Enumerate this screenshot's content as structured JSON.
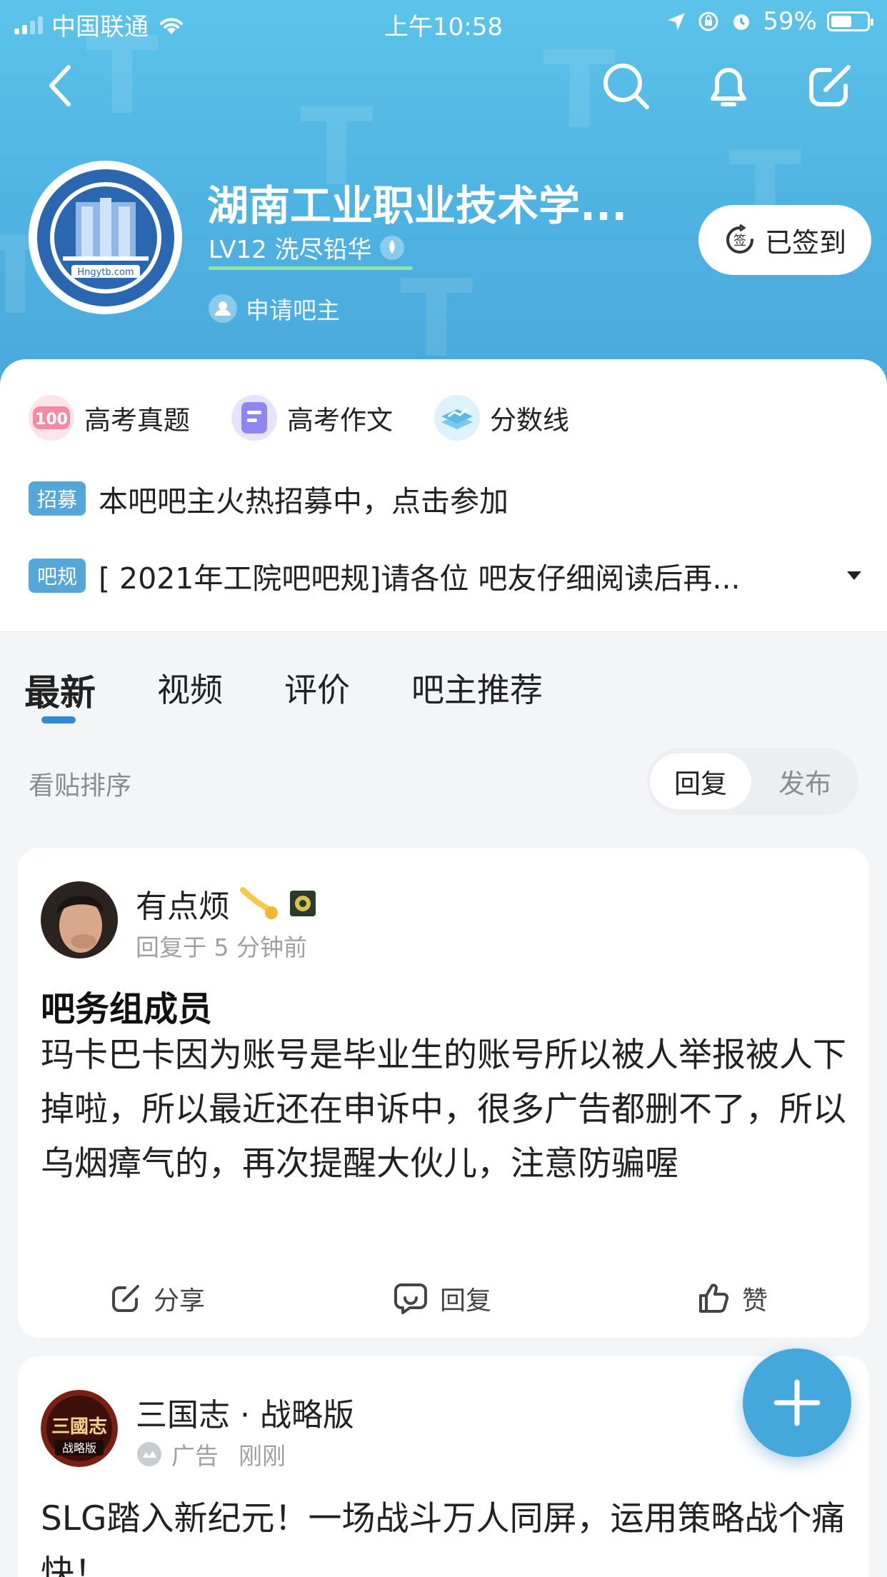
{
  "status_bar": {
    "carrier": "中国联通",
    "time": "上午10:58",
    "battery": "59%",
    "battery_level": 0.59
  },
  "forum": {
    "name": "湖南工业职业技术学...",
    "level": "LV12 洗尽铅华",
    "level_progress": 1.0,
    "apply_admin": "申请吧主",
    "checkin_label": "已签到",
    "checkin_icon_char": "签",
    "avatar_url_text": "Hngytb.com"
  },
  "shortcuts": [
    {
      "label": "高考真题",
      "icon": "100-icon",
      "color": "#f59ab0"
    },
    {
      "label": "高考作文",
      "icon": "essay-icon",
      "color": "#8f86f0"
    },
    {
      "label": "分数线",
      "icon": "score-icon",
      "color": "#5ab9e6"
    }
  ],
  "notices": [
    {
      "tag": "招募",
      "text": "本吧吧主火热招募中，点击参加"
    },
    {
      "tag": "吧规",
      "text": "[ 2021年工院吧吧规]请各位 吧友仔细阅读后再..."
    }
  ],
  "tabs": [
    "最新",
    "视频",
    "评价",
    "吧主推荐"
  ],
  "sort": {
    "label": "看贴排序",
    "options": [
      "回复",
      "发布"
    ],
    "selected": "回复"
  },
  "posts": [
    {
      "user": "有点烦",
      "meta": "回复于 5 分钟前",
      "title": "吧务组成员",
      "body": "玛卡巴卡因为账号是毕业生的账号所以被人举报被人下掉啦，所以最近还在申诉中，很多广告都删不了，所以乌烟瘴气的，再次提醒大伙儿，注意防骗喔",
      "actions": [
        "分享",
        "回复",
        "赞"
      ]
    },
    {
      "user": "三国志 · 战略版",
      "ad_label": "广告",
      "time": "刚刚",
      "body": "SLG踏入新纪元！一场战斗万人同屏，运用策略战个痛快！",
      "avatar_text": "三國志",
      "avatar_sub": "战略版"
    }
  ],
  "colors": {
    "accent": "#4fb3e2",
    "tag": "#55a6d9",
    "fab": "#45a8dc"
  }
}
